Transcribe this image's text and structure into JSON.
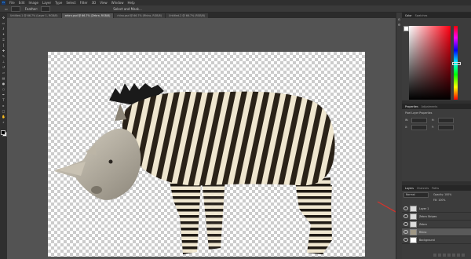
{
  "app": {
    "logo": "Ps",
    "brand_color": "#31a8ff"
  },
  "menu": [
    "File",
    "Edit",
    "Image",
    "Layer",
    "Type",
    "Select",
    "Filter",
    "3D",
    "View",
    "Window",
    "Help"
  ],
  "options_bar": {
    "tool_icon": "marquee-icon",
    "feather_label": "Feather:",
    "select_mask_label": "Select and Mask..."
  },
  "tabs": [
    {
      "label": "Untitled-1 @ 66.7% (Layer 1, RGB/8)",
      "active": false
    },
    {
      "label": "zebra.psd @ 66.7% (Zebra, RGB/8)",
      "active": true
    },
    {
      "label": "rhino.psd @ 66.7% (Rhino, RGB/8)",
      "active": false
    },
    {
      "label": "Untitled-2 @ 66.7% (RGB/8)",
      "active": false
    }
  ],
  "tools": [
    "move-icon",
    "marquee-icon",
    "lasso-icon",
    "magic-wand-icon",
    "crop-icon",
    "eyedropper-icon",
    "healing-brush-icon",
    "brush-icon",
    "clone-stamp-icon",
    "history-brush-icon",
    "eraser-icon",
    "gradient-icon",
    "blur-icon",
    "dodge-icon",
    "pen-icon",
    "type-icon",
    "path-selection-icon",
    "rectangle-icon",
    "hand-icon",
    "zoom-icon"
  ],
  "panels": {
    "color_tabs": [
      "Color",
      "Swatches"
    ],
    "properties_tabs": [
      "Properties",
      "Adjustments"
    ],
    "properties_title": "Pixel Layer Properties",
    "properties_fields": [
      "W:",
      "H:",
      "X:",
      "Y:"
    ],
    "layers_tabs": [
      "Layers",
      "Channels",
      "Paths"
    ],
    "blend_mode": "Normal",
    "opacity_label": "Opacity: 100%",
    "fill_label": "Fill: 100%",
    "layers": [
      {
        "name": "Layer 1",
        "selected": false
      },
      {
        "name": "Zebra Stripes",
        "selected": false
      },
      {
        "name": "Zebra",
        "selected": false
      },
      {
        "name": "Rhino",
        "selected": true
      },
      {
        "name": "Background",
        "selected": false
      }
    ]
  },
  "canvas": {
    "checker_light": "#ffffff",
    "checker_dark": "#cccccc",
    "annotation_arrow_color": "#d6322b"
  }
}
